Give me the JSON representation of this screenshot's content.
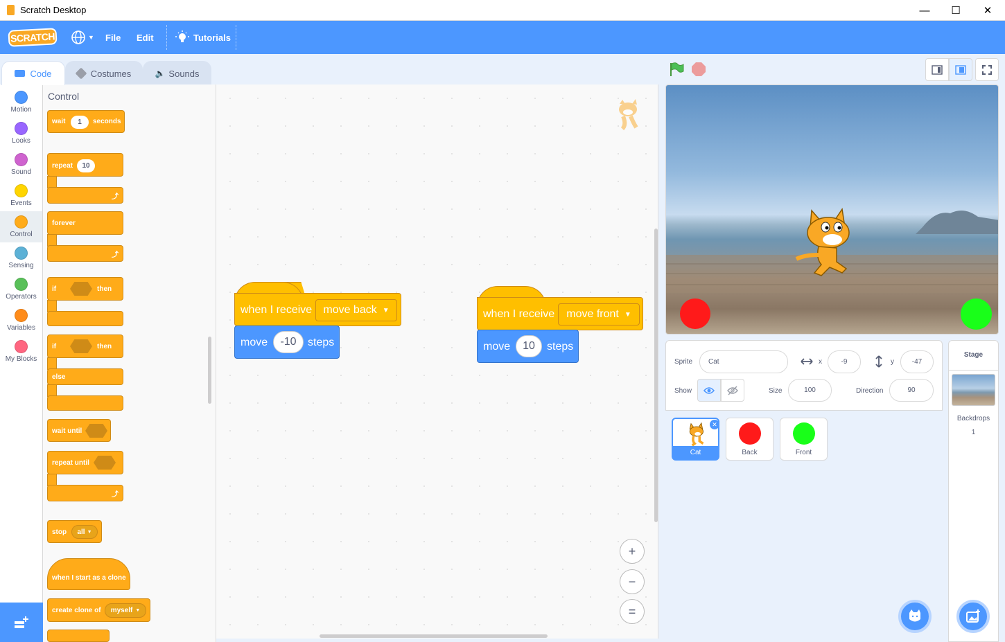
{
  "window": {
    "title": "Scratch Desktop",
    "minimize": "—",
    "maximize": "☐",
    "close": "✕"
  },
  "menubar": {
    "logo": "SCRATCH",
    "file": "File",
    "edit": "Edit",
    "tutorials": "Tutorials"
  },
  "tabs": {
    "code": "Code",
    "costumes": "Costumes",
    "sounds": "Sounds"
  },
  "categories": [
    {
      "label": "Motion",
      "color": "#4c97ff"
    },
    {
      "label": "Looks",
      "color": "#9966ff"
    },
    {
      "label": "Sound",
      "color": "#cf63cf"
    },
    {
      "label": "Events",
      "color": "#ffd500"
    },
    {
      "label": "Control",
      "color": "#ffab19"
    },
    {
      "label": "Sensing",
      "color": "#5cb1d6"
    },
    {
      "label": "Operators",
      "color": "#59c059"
    },
    {
      "label": "Variables",
      "color": "#ff8c1a"
    },
    {
      "label": "My Blocks",
      "color": "#ff6680"
    }
  ],
  "palette": {
    "heading": "Control",
    "wait": {
      "label": "wait",
      "value": "1",
      "suffix": "seconds"
    },
    "repeat": {
      "label": "repeat",
      "value": "10"
    },
    "forever": "forever",
    "if_then": {
      "if": "if",
      "then": "then"
    },
    "if_else": {
      "if": "if",
      "then": "then",
      "else": "else"
    },
    "wait_until": "wait until",
    "repeat_until": "repeat until",
    "stop": {
      "label": "stop",
      "option": "all"
    },
    "when_clone": "when I start as a clone",
    "create_clone": {
      "label": "create clone of",
      "option": "myself"
    }
  },
  "scripts": [
    {
      "hat": "when I receive",
      "message": "move back",
      "action": "move",
      "value": "-10",
      "unit": "steps"
    },
    {
      "hat": "when I receive",
      "message": "move front",
      "action": "move",
      "value": "10",
      "unit": "steps"
    }
  ],
  "zoom": {
    "in": "+",
    "out": "−",
    "reset": "="
  },
  "sprite_info": {
    "sprite_label": "Sprite",
    "sprite_name": "Cat",
    "x_label": "x",
    "x": "-9",
    "y_label": "y",
    "y": "-47",
    "show_label": "Show",
    "size_label": "Size",
    "size": "100",
    "direction_label": "Direction",
    "direction": "90"
  },
  "sprites": [
    {
      "name": "Cat",
      "selected": true
    },
    {
      "name": "Back",
      "color": "#ff1a1a"
    },
    {
      "name": "Front",
      "color": "#19ff19"
    }
  ],
  "stage_panel": {
    "title": "Stage",
    "backdrops_label": "Backdrops",
    "backdrops_count": "1"
  },
  "stage_sprites": {
    "back_color": "#ff1a1a",
    "front_color": "#19ff19"
  }
}
